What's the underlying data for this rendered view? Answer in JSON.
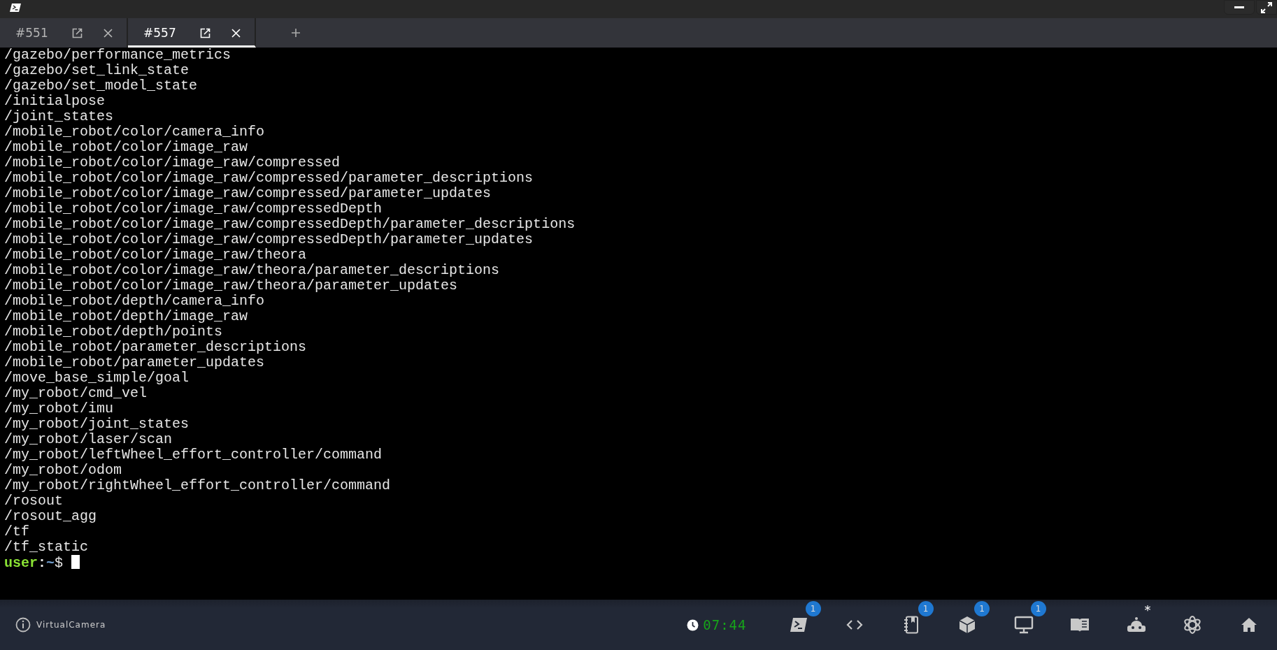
{
  "tabs": [
    {
      "label": "#551",
      "selected": false
    },
    {
      "label": "#557",
      "selected": true
    }
  ],
  "terminal": {
    "lines": [
      "/gazebo/performance_metrics",
      "/gazebo/set_link_state",
      "/gazebo/set_model_state",
      "/initialpose",
      "/joint_states",
      "/mobile_robot/color/camera_info",
      "/mobile_robot/color/image_raw",
      "/mobile_robot/color/image_raw/compressed",
      "/mobile_robot/color/image_raw/compressed/parameter_descriptions",
      "/mobile_robot/color/image_raw/compressed/parameter_updates",
      "/mobile_robot/color/image_raw/compressedDepth",
      "/mobile_robot/color/image_raw/compressedDepth/parameter_descriptions",
      "/mobile_robot/color/image_raw/compressedDepth/parameter_updates",
      "/mobile_robot/color/image_raw/theora",
      "/mobile_robot/color/image_raw/theora/parameter_descriptions",
      "/mobile_robot/color/image_raw/theora/parameter_updates",
      "/mobile_robot/depth/camera_info",
      "/mobile_robot/depth/image_raw",
      "/mobile_robot/depth/points",
      "/mobile_robot/parameter_descriptions",
      "/mobile_robot/parameter_updates",
      "/move_base_simple/goal",
      "/my_robot/cmd_vel",
      "/my_robot/imu",
      "/my_robot/joint_states",
      "/my_robot/laser/scan",
      "/my_robot/leftWheel_effort_controller/command",
      "/my_robot/odom",
      "/my_robot/rightWheel_effort_controller/command",
      "/rosout",
      "/rosout_agg",
      "/tf",
      "/tf_static"
    ],
    "prompt": {
      "user": "user",
      "separator": ":",
      "path": "~",
      "symbol": "$"
    }
  },
  "dock": {
    "status": "VirtualCamera",
    "time": "07:44",
    "tools": [
      {
        "kind": "terminal",
        "badge": "1"
      },
      {
        "kind": "code"
      },
      {
        "kind": "notebook",
        "badge": "1"
      },
      {
        "kind": "cube",
        "badge": "1"
      },
      {
        "kind": "monitor",
        "badge": "1"
      },
      {
        "kind": "book"
      },
      {
        "kind": "robot",
        "badge": "*"
      },
      {
        "kind": "knot"
      },
      {
        "kind": "home"
      }
    ]
  }
}
